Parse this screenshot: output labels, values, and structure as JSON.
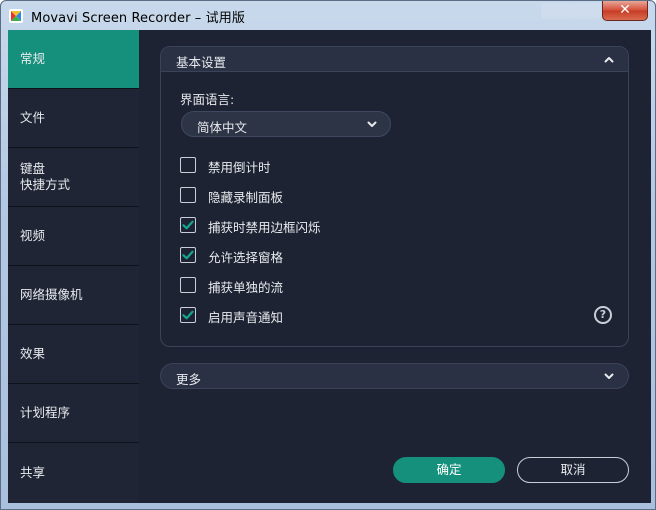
{
  "window": {
    "title": "Movavi Screen Recorder – 试用版",
    "close_glyph": "✕"
  },
  "sidebar": {
    "items": [
      {
        "label": "常规",
        "active": true
      },
      {
        "label": "文件"
      },
      {
        "label": "键盘\n快捷方式"
      },
      {
        "label": "视频"
      },
      {
        "label": "网络摄像机"
      },
      {
        "label": "效果"
      },
      {
        "label": "计划程序"
      },
      {
        "label": "共享"
      }
    ]
  },
  "basic": {
    "title": "基本设置",
    "language_label": "界面语言:",
    "language_value": "简体中文",
    "options": [
      {
        "label": "禁用倒计时",
        "checked": false
      },
      {
        "label": "隐藏录制面板",
        "checked": false
      },
      {
        "label": "捕获时禁用边框闪烁",
        "checked": true
      },
      {
        "label": "允许选择窗格",
        "checked": true
      },
      {
        "label": "捕获单独的流",
        "checked": false
      },
      {
        "label": "启用声音通知",
        "checked": true
      }
    ],
    "help_glyph": "?"
  },
  "more": {
    "label": "更多"
  },
  "buttons": {
    "ok": "确定",
    "cancel": "取消"
  },
  "colors": {
    "accent": "#15907d",
    "panel": "#1d2333",
    "sidebar": "#1f2535"
  },
  "icons": {
    "collapse": "chevron-up-icon",
    "expand": "chevron-down-icon",
    "help": "help-circle-icon",
    "check": "check-icon"
  }
}
